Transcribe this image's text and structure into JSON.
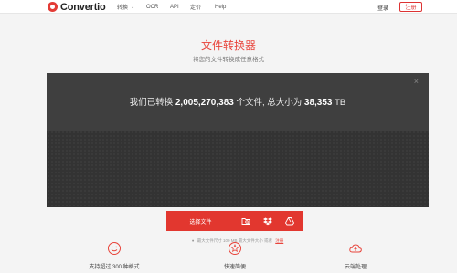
{
  "brand": {
    "name": "Convertio"
  },
  "nav": {
    "items": [
      {
        "label": "转换"
      },
      {
        "label": "OCR"
      },
      {
        "label": "API"
      },
      {
        "label": "定价"
      },
      {
        "label": "Help"
      }
    ]
  },
  "account": {
    "login_label": "登录",
    "signup_label": "注册"
  },
  "hero": {
    "title": "文件转换器",
    "subtitle": "将您的文件转换成任意格式"
  },
  "stats": {
    "prefix": "我们已转换",
    "files_count": "2,005,270,383",
    "middle": "个文件, 总大小为",
    "total_size": "38,353",
    "unit": "TB"
  },
  "upload": {
    "choose_label": "选择文件",
    "sources": [
      "folder-search-icon",
      "dropbox-icon",
      "google-drive-icon"
    ],
    "note_text": "最大文件尺寸 100 MB 最大文件大小 或者",
    "register_link": "注册"
  },
  "features": [
    {
      "icon": "smile-icon",
      "label": "支持超过 300 种格式"
    },
    {
      "icon": "star-icon",
      "label": "快速简便"
    },
    {
      "icon": "cloud-icon",
      "label": "云端处理"
    }
  ],
  "colors": {
    "accent": "#e2372f",
    "panel": "#3a3a3a",
    "background": "#f4f4f4"
  }
}
